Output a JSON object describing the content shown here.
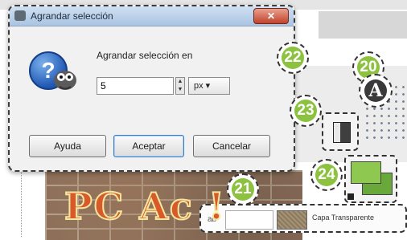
{
  "dialog": {
    "title": "Agrandar selección",
    "close_label": "✕",
    "prompt": "Agrandar selección en",
    "value": "5",
    "unit": "px ▾",
    "buttons": {
      "help": "Ayuda",
      "ok": "Aceptar",
      "cancel": "Cancelar"
    }
  },
  "callouts": [
    "22",
    "20",
    "23",
    "24",
    "21"
  ],
  "toolbox": {
    "text_tool_letter": "A"
  },
  "canvas": {
    "graffiti_text": "PC Ac  !"
  },
  "layers": {
    "visibility_label": "ab",
    "layer_name": "Capa Transparente"
  },
  "colors": {
    "callout_green": "#8cc23f",
    "foreground": "#8fc850",
    "background": "#69a83a"
  }
}
